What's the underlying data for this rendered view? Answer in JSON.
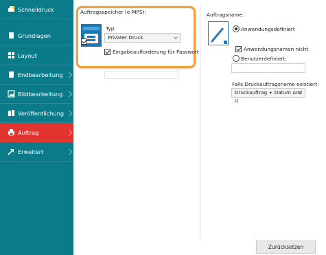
{
  "sidebar": {
    "items": [
      {
        "label": "Schnelldruck",
        "icon": "printer-quick-icon"
      },
      {
        "label": "Grundlagen",
        "icon": "page-icon"
      },
      {
        "label": "Layout",
        "icon": "grid-icon"
      },
      {
        "label": "Endbearbeitung",
        "icon": "page-icon"
      },
      {
        "label": "Bildbearbeitung",
        "icon": "image-icon"
      },
      {
        "label": "Veröffentlichung",
        "icon": "booklet-icon"
      },
      {
        "label": "Auftrag",
        "icon": "printer-icon"
      },
      {
        "label": "Erweitert",
        "icon": "arrow-icon"
      }
    ],
    "active_index": 6,
    "accent_color": "#e2342e",
    "background_color": "#0b7b8a"
  },
  "storage": {
    "heading": "Auftragsspeicher (e-MPS):",
    "type_label": "Typ:",
    "type_value": "Privater Druck",
    "password_prompt_label": "Eingabeaufforderung für Passwort",
    "password_prompt_checked": true
  },
  "jobname": {
    "heading": "Auftragsname:",
    "radio_app_defined": "Anwendungsdefiniert",
    "app_name_not_label": "Anwendungsnamen nicht",
    "app_name_not_checked": true,
    "radio_user_defined": "Benutzerdefiniert:",
    "user_defined_value": "",
    "exists_label": "Falls Druckauftragsname existiert:",
    "exists_value": "Druckauftrag + Datum und U"
  },
  "footer": {
    "reset_label": "Zurücksetzen"
  },
  "highlight_color": "#f0a040"
}
